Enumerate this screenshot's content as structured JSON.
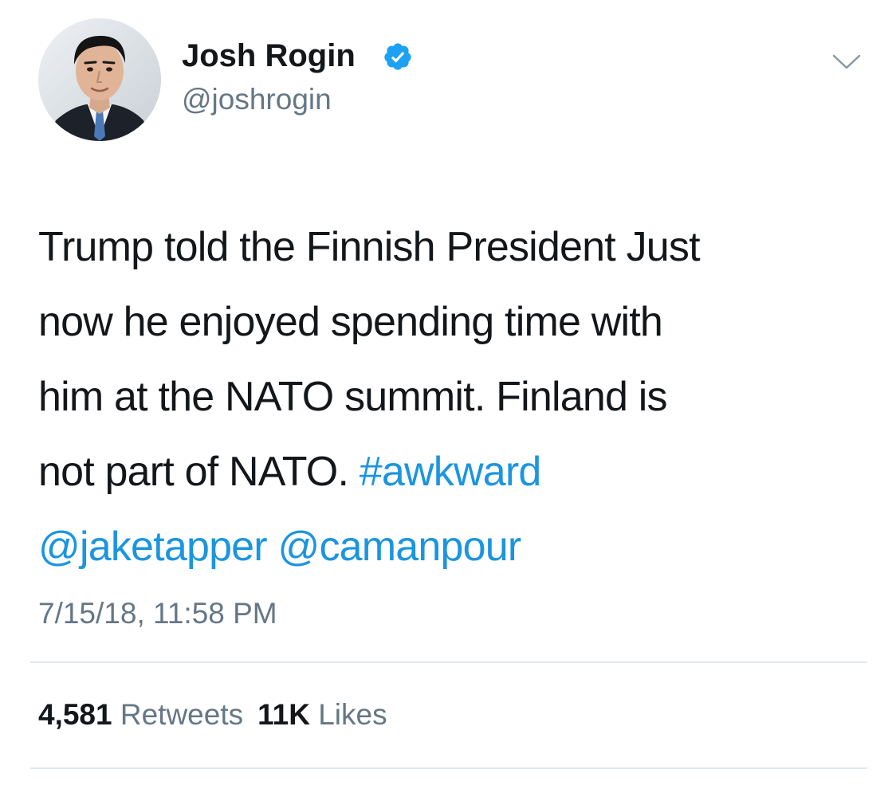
{
  "author": {
    "display_name": "Josh Rogin",
    "handle": "@joshrogin",
    "verified": true,
    "avatar_icon": "profile-photo"
  },
  "menu": {
    "icon": "chevron-down-icon"
  },
  "tweet": {
    "lines": [
      [
        {
          "text": "Trump told the Finnish President Just",
          "type": "text"
        }
      ],
      [
        {
          "text": "now he enjoyed spending time with",
          "type": "text"
        }
      ],
      [
        {
          "text": "him at the NATO summit. Finland is",
          "type": "text"
        }
      ],
      [
        {
          "text": "not part of NATO. ",
          "type": "text"
        },
        {
          "text": "#awkward",
          "type": "hashtag"
        }
      ],
      [
        {
          "text": "@jaketapper",
          "type": "mention"
        },
        {
          "text": " ",
          "type": "text"
        },
        {
          "text": "@camanpour",
          "type": "mention"
        }
      ]
    ],
    "timestamp": "7/15/18, 11:58 PM"
  },
  "stats": {
    "retweets_count": "4,581",
    "retweets_label": "Retweets",
    "likes_count": "11K",
    "likes_label": "Likes"
  },
  "colors": {
    "link": "#1b95e0",
    "text": "#14171a",
    "secondary": "#657786",
    "divider": "#e1e8ed",
    "verified": "#1da1f2"
  }
}
